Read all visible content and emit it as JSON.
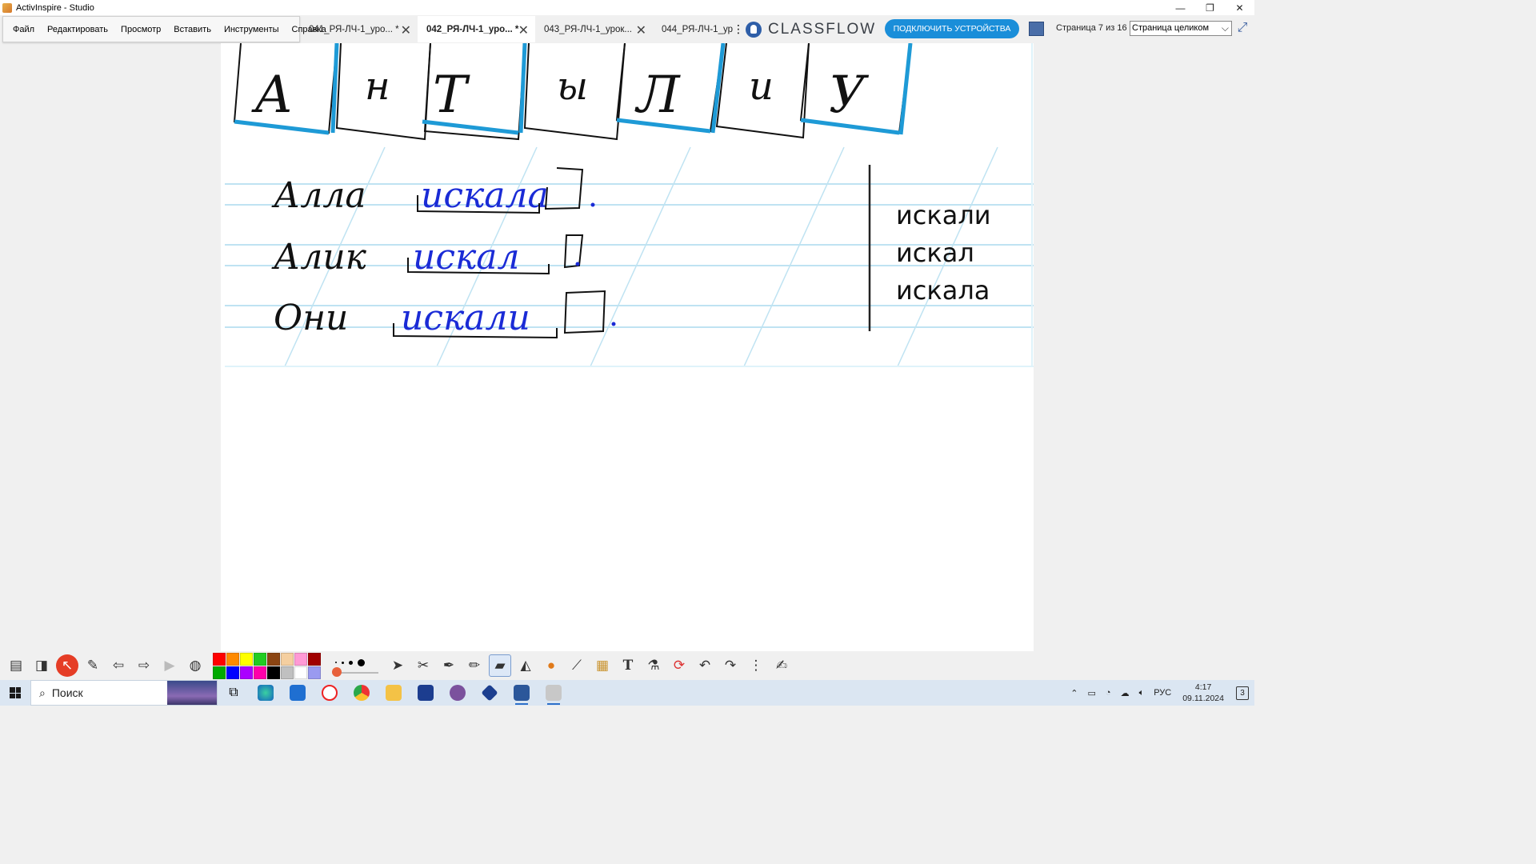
{
  "window": {
    "title": "ActivInspire - Studio",
    "minimize": "—",
    "restore": "❐",
    "close": "✕"
  },
  "menu": [
    "Файл",
    "Редактировать",
    "Просмотр",
    "Вставить",
    "Инструменты",
    "Справка"
  ],
  "tabs": [
    {
      "label": "041_РЯ-ЛЧ-1_уро... *",
      "active": false
    },
    {
      "label": "042_РЯ-ЛЧ-1_уро... *",
      "active": true
    },
    {
      "label": "043_РЯ-ЛЧ-1_урок...",
      "active": false
    },
    {
      "label": "044_РЯ-ЛЧ-1_уро",
      "active": false
    }
  ],
  "tab_close": "✕",
  "tab_more": "⋮",
  "classflow": {
    "logo_text": "CLASSFLOW",
    "connect_label": "ПОДКЛЮЧИТЬ УСТРОЙСТВА"
  },
  "page": {
    "counter": "Страница 7 из 16",
    "zoom": "Страница целиком",
    "zoom_options": [
      "Страница целиком"
    ]
  },
  "lesson": {
    "letters": [
      "А",
      "н",
      "Т",
      "ы",
      "Л",
      "и",
      "У"
    ],
    "sentences": [
      {
        "subject": "Алла",
        "verb": "искала",
        "ending": "а"
      },
      {
        "subject": "Алик",
        "verb": "искал",
        "ending": ""
      },
      {
        "subject": "Они",
        "verb": "искали",
        "ending": "и"
      }
    ],
    "word_list": [
      "искали",
      "искал",
      "искала"
    ]
  },
  "toolbar": {
    "palette": [
      "#ff0000",
      "#ff8a00",
      "#ffff00",
      "#22cc22",
      "#8b4513",
      "#f5cfa0",
      "#ff9ad5",
      "#a00000",
      "#00aa00",
      "#0000ff",
      "#aa00ff",
      "#ff00aa",
      "#000000",
      "#c0c0c0",
      "#ffffff",
      "#9a9af0"
    ],
    "icons": [
      "flipchart-icon",
      "profile-icon",
      "mute-icon",
      "desktop-annotate-icon",
      "prev-page-icon",
      "next-page-icon",
      "play-icon",
      "globe-icon",
      "select-icon",
      "tools-icon",
      "pen-icon",
      "highlighter-icon",
      "eraser-icon",
      "fill-icon",
      "shape-icon",
      "connector-icon",
      "resource-icon",
      "text-icon",
      "clear-icon",
      "reset-icon",
      "undo-icon",
      "redo-icon",
      "more-icon",
      "dock-icon"
    ]
  },
  "taskbar": {
    "search_placeholder": "Поиск",
    "lang": "РУС",
    "time": "4:17",
    "date": "09.11.2024",
    "notifications": "3"
  }
}
